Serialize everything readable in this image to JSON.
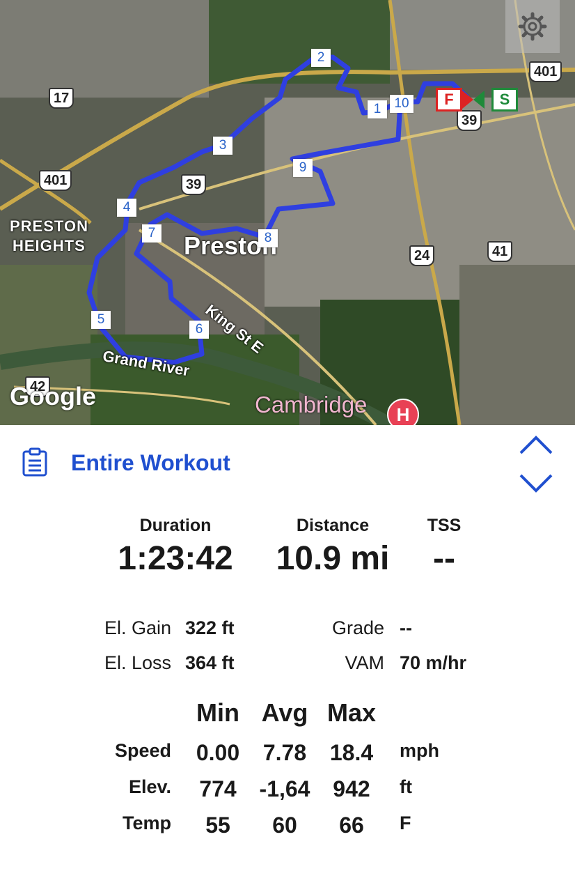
{
  "map": {
    "settings_icon": "gear-icon",
    "laps": [
      "1",
      "2",
      "3",
      "4",
      "5",
      "6",
      "7",
      "8",
      "9",
      "10"
    ],
    "start_label": "S",
    "finish_label": "F",
    "highway_labels": [
      "401",
      "401",
      "17",
      "39",
      "39",
      "24",
      "41",
      "42"
    ],
    "place_labels": {
      "preston_heights_1": "PRESTON",
      "preston_heights_2": "HEIGHTS",
      "preston": "Preston",
      "king_st": "King St E",
      "grand_river": "Grand River",
      "cambridge": "Cambridge"
    },
    "hospital_icon": "H",
    "google": "Google",
    "route_color": "#2f3fe0"
  },
  "panel": {
    "title": "Entire Workout",
    "title_icon": "clipboard-icon",
    "summary": [
      {
        "label": "Duration",
        "value": "1:23:42"
      },
      {
        "label": "Distance",
        "value": "10.9 mi"
      },
      {
        "label": "TSS",
        "value": "--"
      }
    ],
    "stats_left": [
      {
        "label": "El. Gain",
        "value": "322 ft"
      },
      {
        "label": "El. Loss",
        "value": "364 ft"
      }
    ],
    "stats_right": [
      {
        "label": "Grade",
        "value": "--"
      },
      {
        "label": "VAM",
        "value": "70 m/hr"
      }
    ],
    "table": {
      "headers": [
        "Min",
        "Avg",
        "Max"
      ],
      "rows": [
        {
          "label": "Speed",
          "min": "0.00",
          "avg": "7.78",
          "max": "18.4",
          "unit": "mph"
        },
        {
          "label": "Elev.",
          "min": "774",
          "avg": "-1,64",
          "max": "942",
          "unit": "ft"
        },
        {
          "label": "Temp",
          "min": "55",
          "avg": "60",
          "max": "66",
          "unit": "F"
        }
      ]
    },
    "accent": "#1f4fcf"
  }
}
